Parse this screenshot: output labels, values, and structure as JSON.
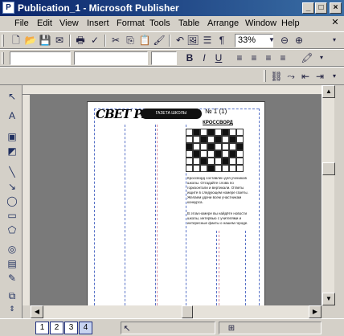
{
  "window": {
    "title": "Publication_1 - Microsoft Publisher",
    "app_icon": "P"
  },
  "menu": [
    "File",
    "Edit",
    "View",
    "Insert",
    "Format",
    "Tools",
    "Table",
    "Arrange",
    "Window",
    "Help"
  ],
  "toolbar": {
    "zoom_value": "33%"
  },
  "format_toolbar": {
    "bold": "B",
    "italic": "I",
    "underline": "U"
  },
  "document": {
    "logo_text": "СВЕТ РАЗУМА",
    "banner_text": "ГАЗЕТА ШКОЛЫ",
    "issue_text": "№ 1 (1)",
    "crossword_title": "КРОССВОРД",
    "text_block_1": "Кроссворд составлен для учеников школы. Отгадайте слова по горизонтали и вертикали. Ответы ищите в следующем номере газеты. Желаем удачи всем участникам конкурса.",
    "text_block_2": "В этом номере вы найдёте новости школы, интервью с учителями и интересные факты о нашем городе."
  },
  "page_tabs": [
    "1",
    "2",
    "3",
    "4"
  ],
  "active_page": "4"
}
